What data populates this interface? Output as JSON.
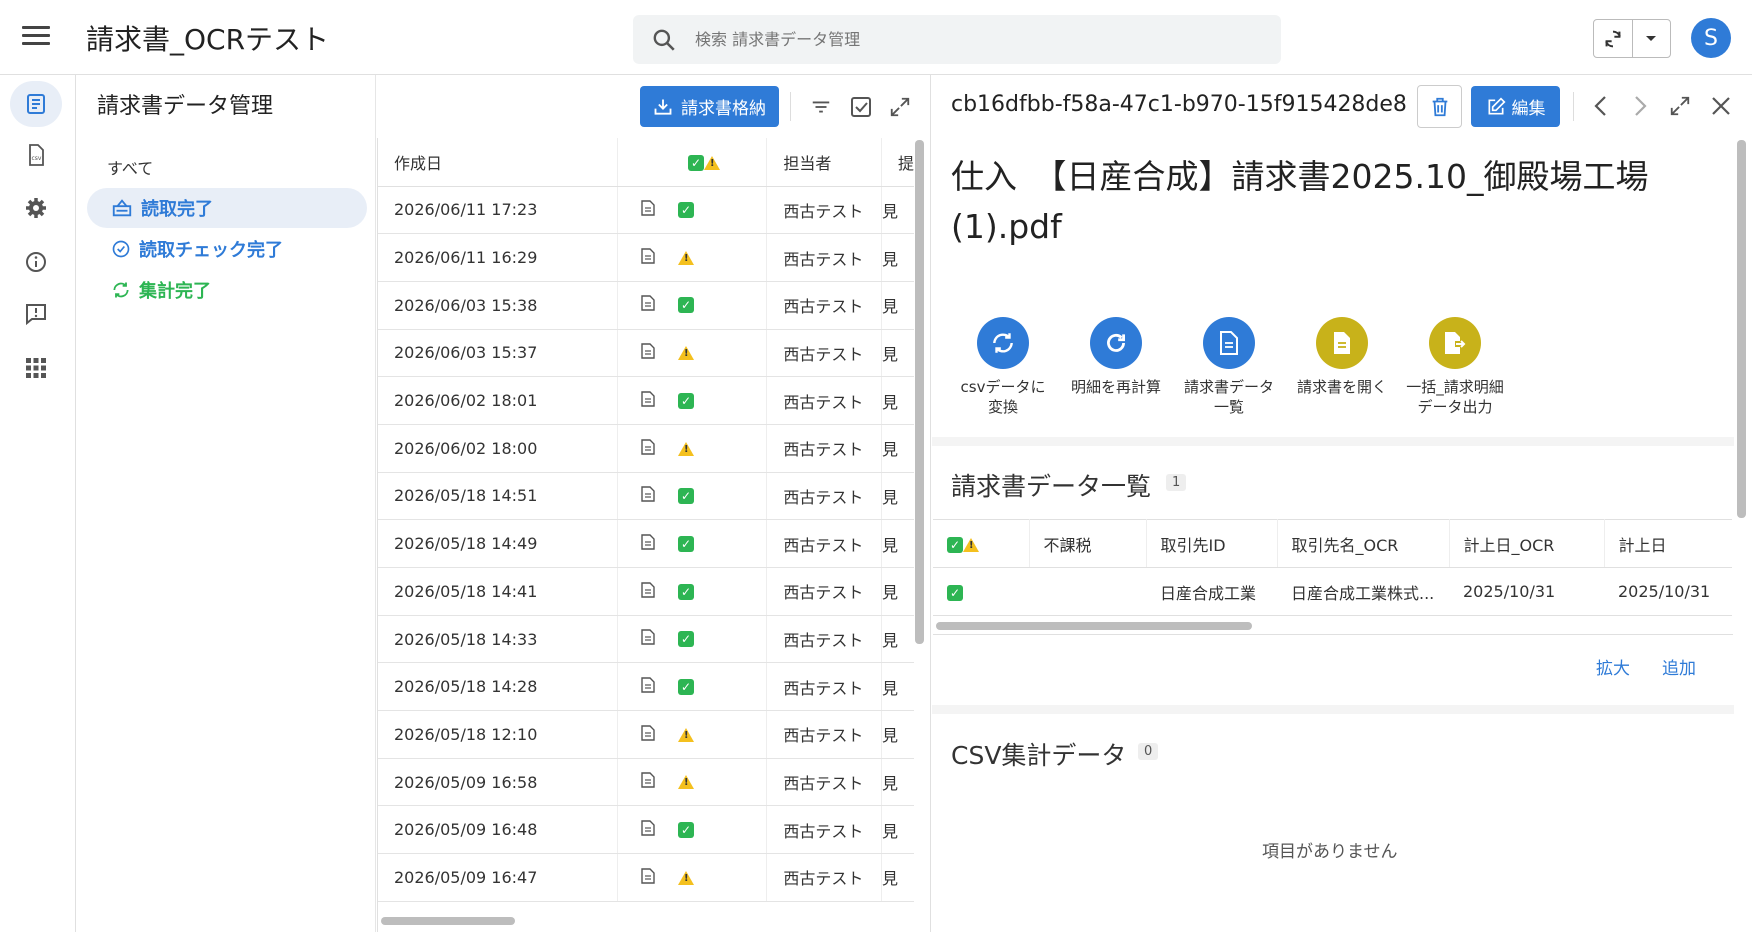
{
  "app": {
    "title": "請求書_OCRテスト",
    "avatar_letter": "S"
  },
  "search": {
    "placeholder": "検索 請求書データ管理"
  },
  "colors": {
    "primary": "#2f7bd7",
    "success": "#2db553",
    "warning": "#f4c01e",
    "olive": "#c8b21a"
  },
  "rail": {
    "icons": [
      "list-icon",
      "csv-file-icon",
      "gear-icon",
      "info-icon",
      "feedback-icon",
      "apps-grid-icon"
    ]
  },
  "panel": {
    "title": "請求書データ管理",
    "store_button": "請求書格納"
  },
  "nav": {
    "all": "すべて",
    "items": [
      {
        "label": "読取完了",
        "icon": "scan-icon",
        "color": "#2f7bd7",
        "active": true
      },
      {
        "label": "読取チェック完了",
        "icon": "check-circle-icon",
        "color": "#2f7bd7",
        "active": false
      },
      {
        "label": "集計完了",
        "icon": "refresh-icon",
        "color": "#2db553",
        "active": false
      }
    ]
  },
  "list": {
    "headers": {
      "created": "作成日",
      "status": "",
      "assignee": "担当者",
      "extra": "提"
    },
    "rows": [
      {
        "date": "2026/06/11 17:23",
        "status": "ok",
        "assignee": "西古テスト",
        "extra": "見"
      },
      {
        "date": "2026/06/11 16:29",
        "status": "warn",
        "assignee": "西古テスト",
        "extra": "見"
      },
      {
        "date": "2026/06/03 15:38",
        "status": "ok",
        "assignee": "西古テスト",
        "extra": "見"
      },
      {
        "date": "2026/06/03 15:37",
        "status": "warn",
        "assignee": "西古テスト",
        "extra": "見"
      },
      {
        "date": "2026/06/02 18:01",
        "status": "ok",
        "assignee": "西古テスト",
        "extra": "見"
      },
      {
        "date": "2026/06/02 18:00",
        "status": "warn",
        "assignee": "西古テスト",
        "extra": "見"
      },
      {
        "date": "2026/05/18 14:51",
        "status": "ok",
        "assignee": "西古テスト",
        "extra": "見"
      },
      {
        "date": "2026/05/18 14:49",
        "status": "ok",
        "assignee": "西古テスト",
        "extra": "見"
      },
      {
        "date": "2026/05/18 14:41",
        "status": "ok",
        "assignee": "西古テスト",
        "extra": "見"
      },
      {
        "date": "2026/05/18 14:33",
        "status": "ok",
        "assignee": "西古テスト",
        "extra": "見"
      },
      {
        "date": "2026/05/18 14:28",
        "status": "ok",
        "assignee": "西古テスト",
        "extra": "見"
      },
      {
        "date": "2026/05/18 12:10",
        "status": "warn",
        "assignee": "西古テスト",
        "extra": "見"
      },
      {
        "date": "2026/05/09 16:58",
        "status": "warn",
        "assignee": "西古テスト",
        "extra": "見"
      },
      {
        "date": "2026/05/09 16:48",
        "status": "ok",
        "assignee": "西古テスト",
        "extra": "見"
      },
      {
        "date": "2026/05/09 16:47",
        "status": "warn",
        "assignee": "西古テスト",
        "extra": "見"
      }
    ]
  },
  "detail": {
    "id": "cb16dfbb-f58a-47c1-b970-15f915428de8",
    "edit_button": "編集",
    "title": "仕入　【日産合成】請求書2025.10_御殿場工場(1).pdf",
    "actions": [
      {
        "label": "csvデータに\n変換",
        "icon": "sync-icon",
        "color": "#2f7bd7"
      },
      {
        "label": "明細を再計算",
        "icon": "redo-icon",
        "color": "#2f7bd7"
      },
      {
        "label": "請求書データ\n一覧",
        "icon": "document-icon",
        "color": "#2f7bd7"
      },
      {
        "label": "請求書を開く",
        "icon": "file-icon",
        "color": "#c8b21a"
      },
      {
        "label": "一括_請求明細\nデータ出力",
        "icon": "export-icon",
        "color": "#c8b21a"
      }
    ],
    "invoice_section": {
      "title": "請求書データ一覧",
      "count": "1",
      "headers": [
        "",
        "不課税",
        "取引先ID",
        "取引先名_OCR",
        "計上日_OCR",
        "計上日"
      ],
      "rows": [
        {
          "status": "ok",
          "tax": "",
          "partner_id": "日産合成工業",
          "partner_name": "日産合成工業株式...",
          "date_ocr": "2025/10/31",
          "date": "2025/10/31"
        }
      ],
      "zoom_label": "拡大",
      "add_label": "追加"
    },
    "csv_section": {
      "title": "CSV集計データ",
      "count": "0",
      "empty": "項目がありません"
    }
  }
}
